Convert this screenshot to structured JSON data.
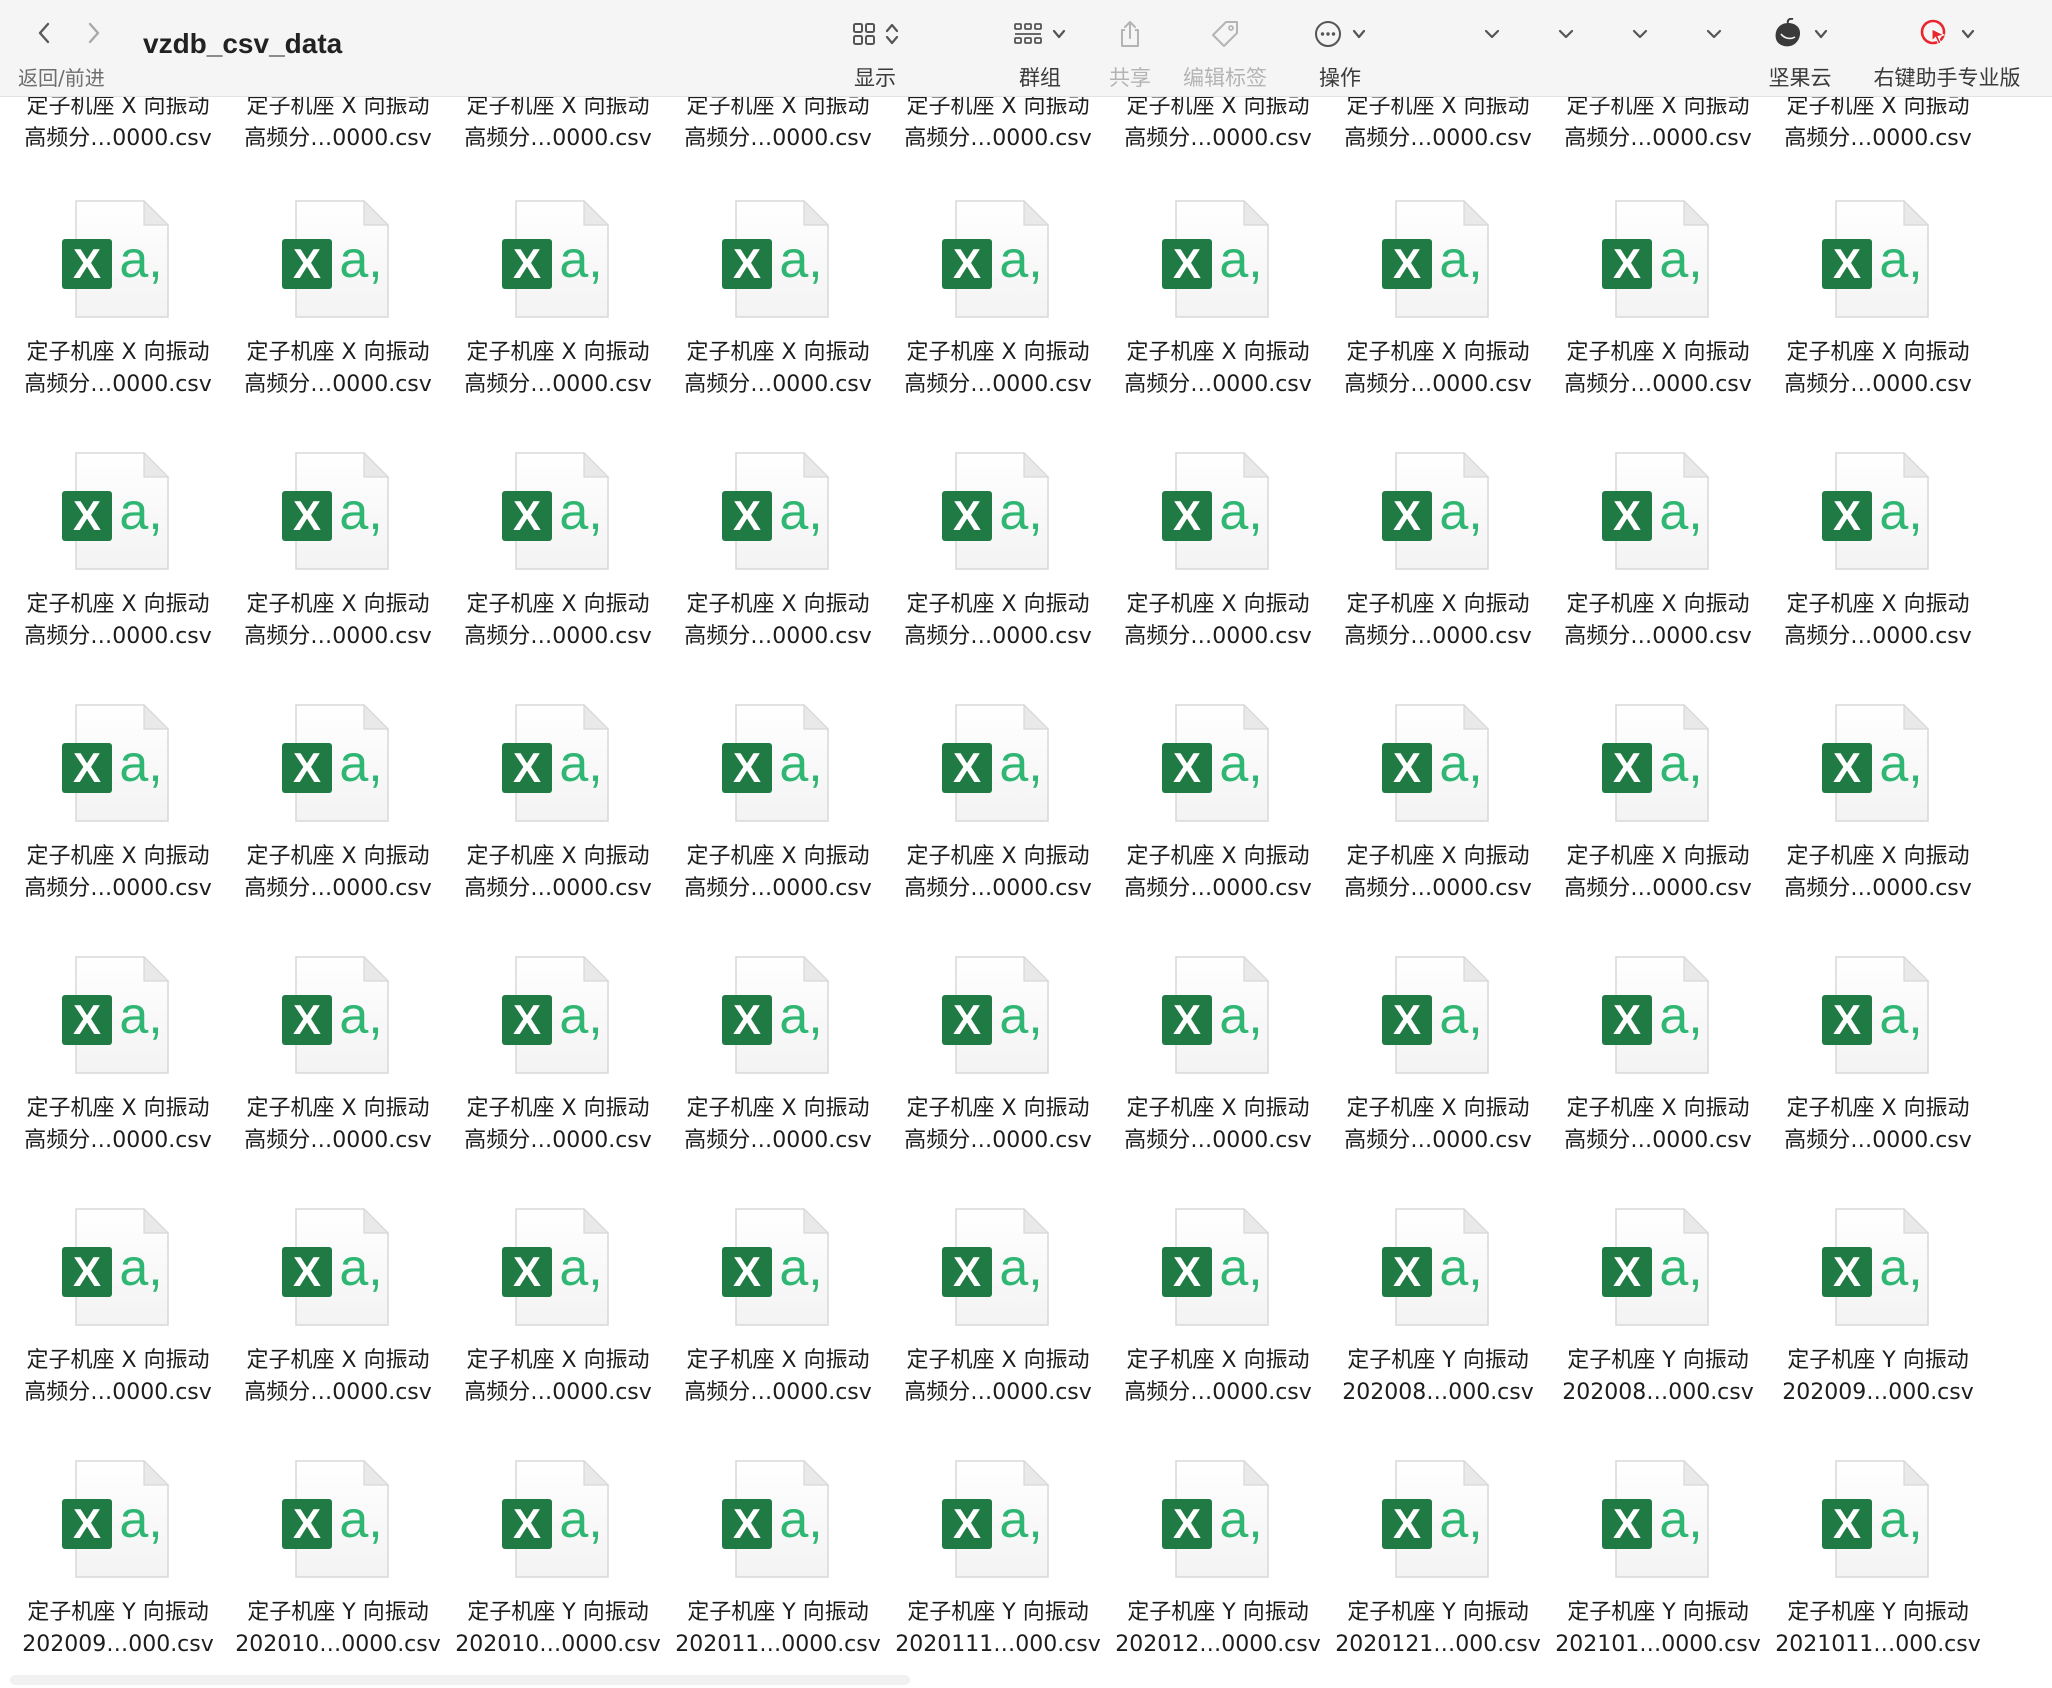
{
  "window": {
    "title": "vzdb_csv_data",
    "nav_label": "返回/前进"
  },
  "toolbar": {
    "view_label": "显示",
    "group_label": "群组",
    "share_label": "共享",
    "tags_label": "编辑标签",
    "action_label": "操作",
    "jianguoyun_label": "坚果云",
    "youjian_label": "右键助手专业版"
  },
  "colors": {
    "excel_dark": "#1f7a43",
    "excel_light": "#2fb673",
    "youjian_red": "#e8262e"
  },
  "files": {
    "top_row": [
      {
        "line1": "定子机座 X 向振动",
        "line2": "高频分…0000.csv"
      },
      {
        "line1": "定子机座 X 向振动",
        "line2": "高频分…0000.csv"
      },
      {
        "line1": "定子机座 X 向振动",
        "line2": "高频分…0000.csv"
      },
      {
        "line1": "定子机座 X 向振动",
        "line2": "高频分…0000.csv"
      },
      {
        "line1": "定子机座 X 向振动",
        "line2": "高频分…0000.csv"
      },
      {
        "line1": "定子机座 X 向振动",
        "line2": "高频分…0000.csv"
      },
      {
        "line1": "定子机座 X 向振动",
        "line2": "高频分…0000.csv"
      },
      {
        "line1": "定子机座 X 向振动",
        "line2": "高频分…0000.csv"
      },
      {
        "line1": "定子机座 X 向振动",
        "line2": "高频分…0000.csv"
      }
    ],
    "grid": [
      {
        "line1": "定子机座 X 向振动",
        "line2": "高频分…0000.csv"
      },
      {
        "line1": "定子机座 X 向振动",
        "line2": "高频分…0000.csv"
      },
      {
        "line1": "定子机座 X 向振动",
        "line2": "高频分…0000.csv"
      },
      {
        "line1": "定子机座 X 向振动",
        "line2": "高频分…0000.csv"
      },
      {
        "line1": "定子机座 X 向振动",
        "line2": "高频分…0000.csv"
      },
      {
        "line1": "定子机座 X 向振动",
        "line2": "高频分…0000.csv"
      },
      {
        "line1": "定子机座 X 向振动",
        "line2": "高频分…0000.csv"
      },
      {
        "line1": "定子机座 X 向振动",
        "line2": "高频分…0000.csv"
      },
      {
        "line1": "定子机座 X 向振动",
        "line2": "高频分…0000.csv"
      },
      {
        "line1": "定子机座 X 向振动",
        "line2": "高频分…0000.csv"
      },
      {
        "line1": "定子机座 X 向振动",
        "line2": "高频分…0000.csv"
      },
      {
        "line1": "定子机座 X 向振动",
        "line2": "高频分…0000.csv"
      },
      {
        "line1": "定子机座 X 向振动",
        "line2": "高频分…0000.csv"
      },
      {
        "line1": "定子机座 X 向振动",
        "line2": "高频分…0000.csv"
      },
      {
        "line1": "定子机座 X 向振动",
        "line2": "高频分…0000.csv"
      },
      {
        "line1": "定子机座 X 向振动",
        "line2": "高频分…0000.csv"
      },
      {
        "line1": "定子机座 X 向振动",
        "line2": "高频分…0000.csv"
      },
      {
        "line1": "定子机座 X 向振动",
        "line2": "高频分…0000.csv"
      },
      {
        "line1": "定子机座 X 向振动",
        "line2": "高频分…0000.csv"
      },
      {
        "line1": "定子机座 X 向振动",
        "line2": "高频分…0000.csv"
      },
      {
        "line1": "定子机座 X 向振动",
        "line2": "高频分…0000.csv"
      },
      {
        "line1": "定子机座 X 向振动",
        "line2": "高频分…0000.csv"
      },
      {
        "line1": "定子机座 X 向振动",
        "line2": "高频分…0000.csv"
      },
      {
        "line1": "定子机座 X 向振动",
        "line2": "高频分…0000.csv"
      },
      {
        "line1": "定子机座 X 向振动",
        "line2": "高频分…0000.csv"
      },
      {
        "line1": "定子机座 X 向振动",
        "line2": "高频分…0000.csv"
      },
      {
        "line1": "定子机座 X 向振动",
        "line2": "高频分…0000.csv"
      },
      {
        "line1": "定子机座 X 向振动",
        "line2": "高频分…0000.csv"
      },
      {
        "line1": "定子机座 X 向振动",
        "line2": "高频分…0000.csv"
      },
      {
        "line1": "定子机座 X 向振动",
        "line2": "高频分…0000.csv"
      },
      {
        "line1": "定子机座 X 向振动",
        "line2": "高频分…0000.csv"
      },
      {
        "line1": "定子机座 X 向振动",
        "line2": "高频分…0000.csv"
      },
      {
        "line1": "定子机座 X 向振动",
        "line2": "高频分…0000.csv"
      },
      {
        "line1": "定子机座 X 向振动",
        "line2": "高频分…0000.csv"
      },
      {
        "line1": "定子机座 X 向振动",
        "line2": "高频分…0000.csv"
      },
      {
        "line1": "定子机座 X 向振动",
        "line2": "高频分…0000.csv"
      },
      {
        "line1": "定子机座 X 向振动",
        "line2": "高频分…0000.csv"
      },
      {
        "line1": "定子机座 X 向振动",
        "line2": "高频分…0000.csv"
      },
      {
        "line1": "定子机座 X 向振动",
        "line2": "高频分…0000.csv"
      },
      {
        "line1": "定子机座 X 向振动",
        "line2": "高频分…0000.csv"
      },
      {
        "line1": "定子机座 X 向振动",
        "line2": "高频分…0000.csv"
      },
      {
        "line1": "定子机座 X 向振动",
        "line2": "高频分…0000.csv"
      },
      {
        "line1": "定子机座 Y 向振动",
        "line2": "202008…000.csv"
      },
      {
        "line1": "定子机座 Y 向振动",
        "line2": "202008…000.csv"
      },
      {
        "line1": "定子机座 Y 向振动",
        "line2": "202009…000.csv"
      },
      {
        "line1": "定子机座 Y 向振动",
        "line2": "202009…000.csv"
      },
      {
        "line1": "定子机座 Y 向振动",
        "line2": "202010…0000.csv"
      },
      {
        "line1": "定子机座 Y 向振动",
        "line2": "202010…0000.csv"
      },
      {
        "line1": "定子机座 Y 向振动",
        "line2": "202011…0000.csv"
      },
      {
        "line1": "定子机座 Y 向振动",
        "line2": "2020111…000.csv"
      },
      {
        "line1": "定子机座 Y 向振动",
        "line2": "202012…0000.csv"
      },
      {
        "line1": "定子机座 Y 向振动",
        "line2": "2020121…000.csv"
      },
      {
        "line1": "定子机座 Y 向振动",
        "line2": "202101…0000.csv"
      },
      {
        "line1": "定子机座 Y 向振动",
        "line2": "2021011…000.csv"
      }
    ]
  }
}
